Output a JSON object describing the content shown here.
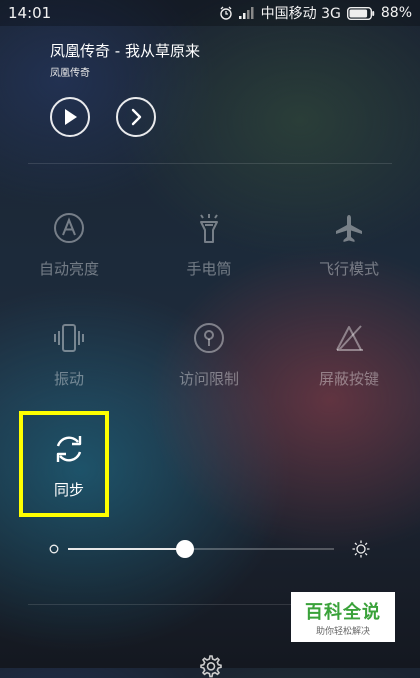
{
  "status_bar": {
    "time": "14:01",
    "carrier": "中国移动 3G",
    "battery": "88%",
    "battery_level": 0.88,
    "icons": [
      "alarm-icon",
      "signal-icon",
      "battery-icon"
    ]
  },
  "media": {
    "title": "凤凰传奇 - 我从草原来",
    "artist": "凤凰传奇",
    "icons": [
      "play-icon",
      "next-icon"
    ]
  },
  "toggles": [
    {
      "label": "自动亮度",
      "icon": "auto-brightness-icon",
      "active": false
    },
    {
      "label": "手电筒",
      "icon": "flashlight-icon",
      "active": false
    },
    {
      "label": "飞行模式",
      "icon": "airplane-icon",
      "active": false
    },
    {
      "label": "振动",
      "icon": "vibrate-icon",
      "active": false
    },
    {
      "label": "访问限制",
      "icon": "access-restriction-icon",
      "active": false
    },
    {
      "label": "屏蔽按键",
      "icon": "block-keys-icon",
      "active": false
    },
    {
      "label": "同步",
      "icon": "sync-icon",
      "active": true
    }
  ],
  "brightness": {
    "value": 0.44,
    "icons": [
      "brightness-low-icon",
      "brightness-high-icon"
    ]
  },
  "watermark": {
    "title": "百科全说",
    "subtitle": "助你轻松解决"
  },
  "colors": {
    "highlight": "#ffff00",
    "watermark_green": "#3aa23a"
  }
}
